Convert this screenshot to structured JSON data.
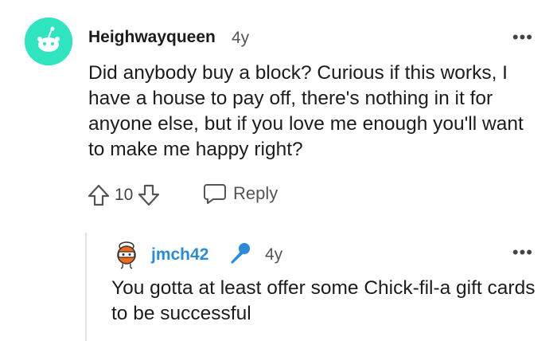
{
  "comment": {
    "username": "Heighwayqueen",
    "age": "4y",
    "more_label": "•••",
    "avatar_icon": "snoo-avatar-icon",
    "body": "Did anybody buy a block? Curious if this works, I have a house to pay off, there's nothing in it for anyone else, but if you love me enough you'll want to make me happy right?",
    "score": "10",
    "reply_label": "Reply",
    "colors": {
      "avatar_bg": "#2ee5c0",
      "text": "#1c1c1c"
    }
  },
  "reply": {
    "username": "jmch42",
    "age": "4y",
    "more_label": "•••",
    "avatar_icon": "snoo-avatar-icon",
    "badge_icon": "microphone-icon",
    "body": "You gotta at least offer some Chick-fil-a gift cards to be successful",
    "colors": {
      "username": "#2a8bd8",
      "badge": "#2a8bd8"
    }
  }
}
